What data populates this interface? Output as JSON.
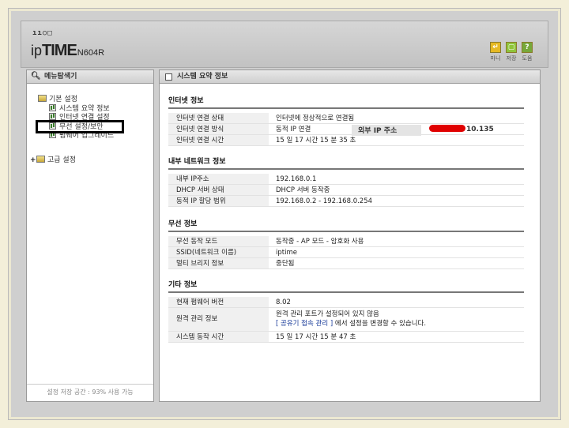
{
  "header": {
    "brand_dots": "ıı○□",
    "brand_ip": "ip",
    "brand_time": "TIME",
    "brand_model": "N604R",
    "buttons": [
      {
        "label": "마니",
        "icon": "↵",
        "color": "#e6b923"
      },
      {
        "label": "저장",
        "icon": "▢",
        "color": "#8fc43a"
      },
      {
        "label": "도움",
        "icon": "?",
        "color": "#77a83a"
      }
    ]
  },
  "sidebar": {
    "title": "메뉴탐색기",
    "tree": {
      "basic": "기본 설정",
      "items": [
        "시스템 요약 정보",
        "인터넷 연결 설정",
        "무선 설정/보안",
        "펌웨어 업그레이드"
      ],
      "advanced": "고급 설정"
    },
    "footer": "설정 저장 공간 : 93% 사용 가능"
  },
  "main": {
    "title": "시스템 요약 정보",
    "internet": {
      "heading": "인터넷 정보",
      "rows": [
        {
          "k": "인터넷 연결 상태",
          "v": "인터넷에 정상적으로 연결됨"
        },
        {
          "k": "인터넷 연결 방식",
          "v": "동적 IP 연결"
        },
        {
          "k": "인터넷 연결 시간",
          "v": "15 일 17 시간 15 분 35 초"
        }
      ],
      "external_ip_label": "외부 IP 주소",
      "external_ip_value": "10.135"
    },
    "internal": {
      "heading": "내부 네트워크 정보",
      "rows": [
        {
          "k": "내부 IP주소",
          "v": "192.168.0.1"
        },
        {
          "k": "DHCP 서버 상태",
          "v": "DHCP 서버 동작중"
        },
        {
          "k": "동적 IP 할당 범위",
          "v": "192.168.0.2 -  192.168.0.254"
        }
      ]
    },
    "wireless": {
      "heading": "무선 정보",
      "rows": [
        {
          "k": "무선 동작 모드",
          "v": "동작중 - AP 모드 - 암호화 사용"
        },
        {
          "k": "SSID(네트워크 이름)",
          "v": "iptime"
        },
        {
          "k": "멀티 브리지 정보",
          "v": "중단됨"
        }
      ]
    },
    "other": {
      "heading": "기타 정보",
      "firmware_label": "현재 펌웨어 버전",
      "firmware_value": "8.02",
      "remote_label": "원격 관리 정보",
      "remote_line1": "원격 관리 포트가 설정되어 있지 않음",
      "remote_link": "[ 공유기 접속 관리 ]",
      "remote_line2_suffix": "에서 설정을 변경할 수 있습니다.",
      "uptime_label": "시스템 동작 시간",
      "uptime_value": "15 일 17 시간 15 분 47 초"
    }
  }
}
